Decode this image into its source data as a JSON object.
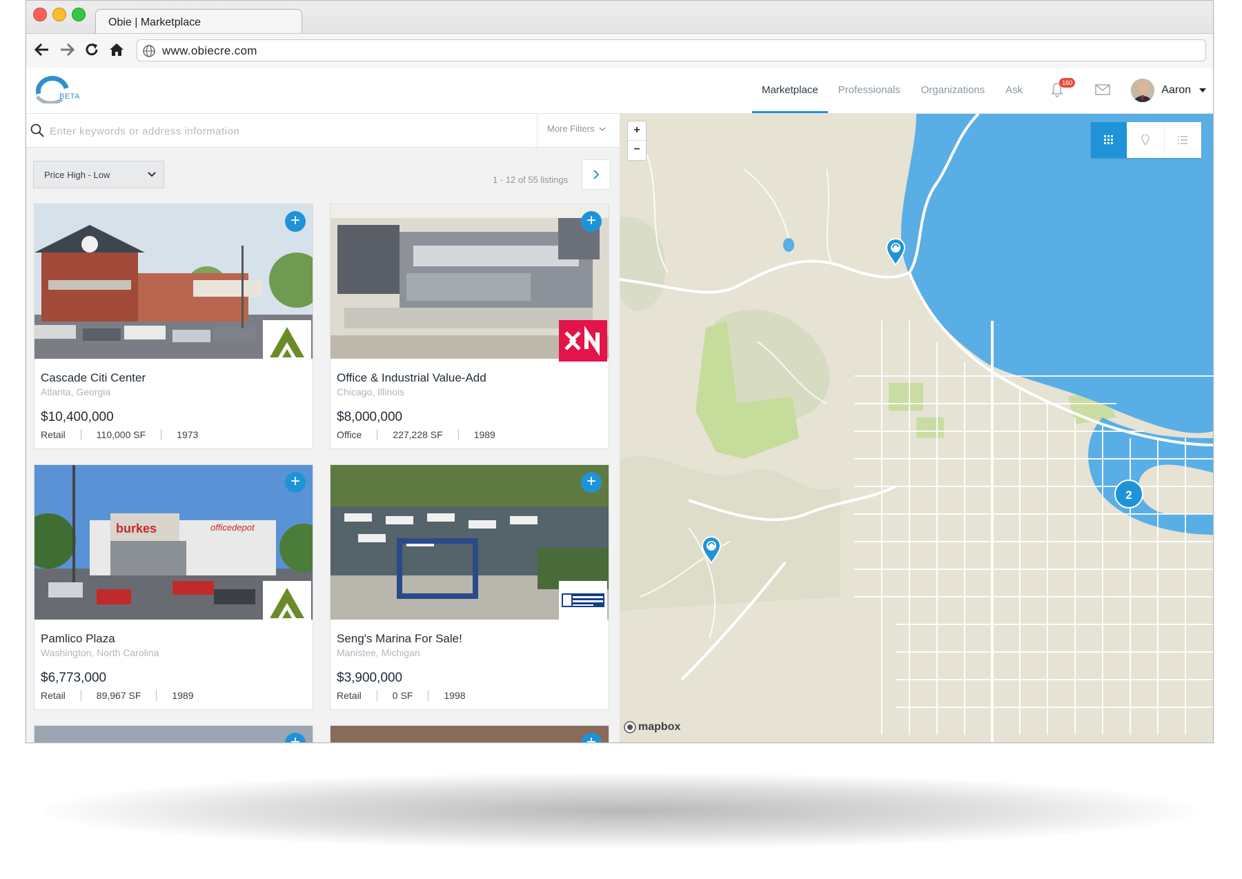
{
  "browser": {
    "tab_title": "Obie | Marketplace",
    "url": "www.obiecre.com"
  },
  "header": {
    "logo_badge": "BETA",
    "nav": [
      {
        "label": "Marketplace",
        "active": true
      },
      {
        "label": "Professionals",
        "active": false
      },
      {
        "label": "Organizations",
        "active": false
      },
      {
        "label": "Ask",
        "active": false
      }
    ],
    "notification_count": "160",
    "user_name": "Aaron"
  },
  "search": {
    "placeholder": "Enter keywords or address information",
    "more_filters": "More Filters"
  },
  "listing_controls": {
    "sort_selected": "Price High - Low",
    "page_count": "1 - 12 of 55 listings"
  },
  "listings": [
    {
      "title": "Cascade Citi Center",
      "location": "Atlanta, Georgia",
      "price": "$10,400,000",
      "type": "Retail",
      "size": "110,000 SF",
      "year": "1973"
    },
    {
      "title": "Office & Industrial Value-Add",
      "location": "Chicago, Illinois",
      "price": "$8,000,000",
      "type": "Office",
      "size": "227,228 SF",
      "year": "1989"
    },
    {
      "title": "Pamlico Plaza",
      "location": "Washington, North Carolina",
      "price": "$6,773,000",
      "type": "Retail",
      "size": "89,967 SF",
      "year": "1989"
    },
    {
      "title": "Seng's Marina For Sale!",
      "location": "Manistee, Michigan",
      "price": "$3,900,000",
      "type": "Retail",
      "size": "0 SF",
      "year": "1998"
    }
  ],
  "map": {
    "zoom_in": "+",
    "zoom_out": "−",
    "cluster_count": "2",
    "attribution": "mapbox",
    "water_color": "#5aaee6",
    "land_color": "#e8e4d8",
    "park_color": "#c9dfa0"
  },
  "colors": {
    "accent": "#1f93d8"
  }
}
